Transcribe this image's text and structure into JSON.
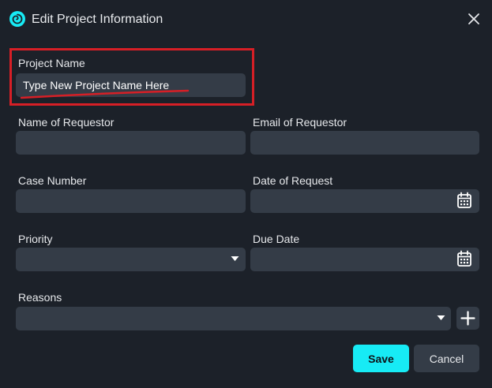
{
  "dialog": {
    "title": "Edit Project Information",
    "app_icon": "swirl-logo-icon",
    "close_icon": "close-icon"
  },
  "fields": {
    "project_name": {
      "label": "Project Name",
      "value": "Type New Project Name Here"
    },
    "requestor_name": {
      "label": "Name of Requestor",
      "value": ""
    },
    "requestor_email": {
      "label": "Email of Requestor",
      "value": ""
    },
    "case_number": {
      "label": "Case Number",
      "value": ""
    },
    "request_date": {
      "label": "Date of Request",
      "value": "",
      "icon": "calendar-icon"
    },
    "priority": {
      "label": "Priority",
      "value": "",
      "icon": "caret-down-icon"
    },
    "due_date": {
      "label": "Due Date",
      "value": "",
      "icon": "calendar-icon"
    },
    "reasons": {
      "label": "Reasons",
      "value": "",
      "icon": "caret-down-icon",
      "add_icon": "plus-icon"
    }
  },
  "buttons": {
    "save": "Save",
    "cancel": "Cancel"
  },
  "colors": {
    "background": "#1c2129",
    "field": "#343c47",
    "accent": "#17ebf5",
    "annotation": "#d61f26"
  }
}
